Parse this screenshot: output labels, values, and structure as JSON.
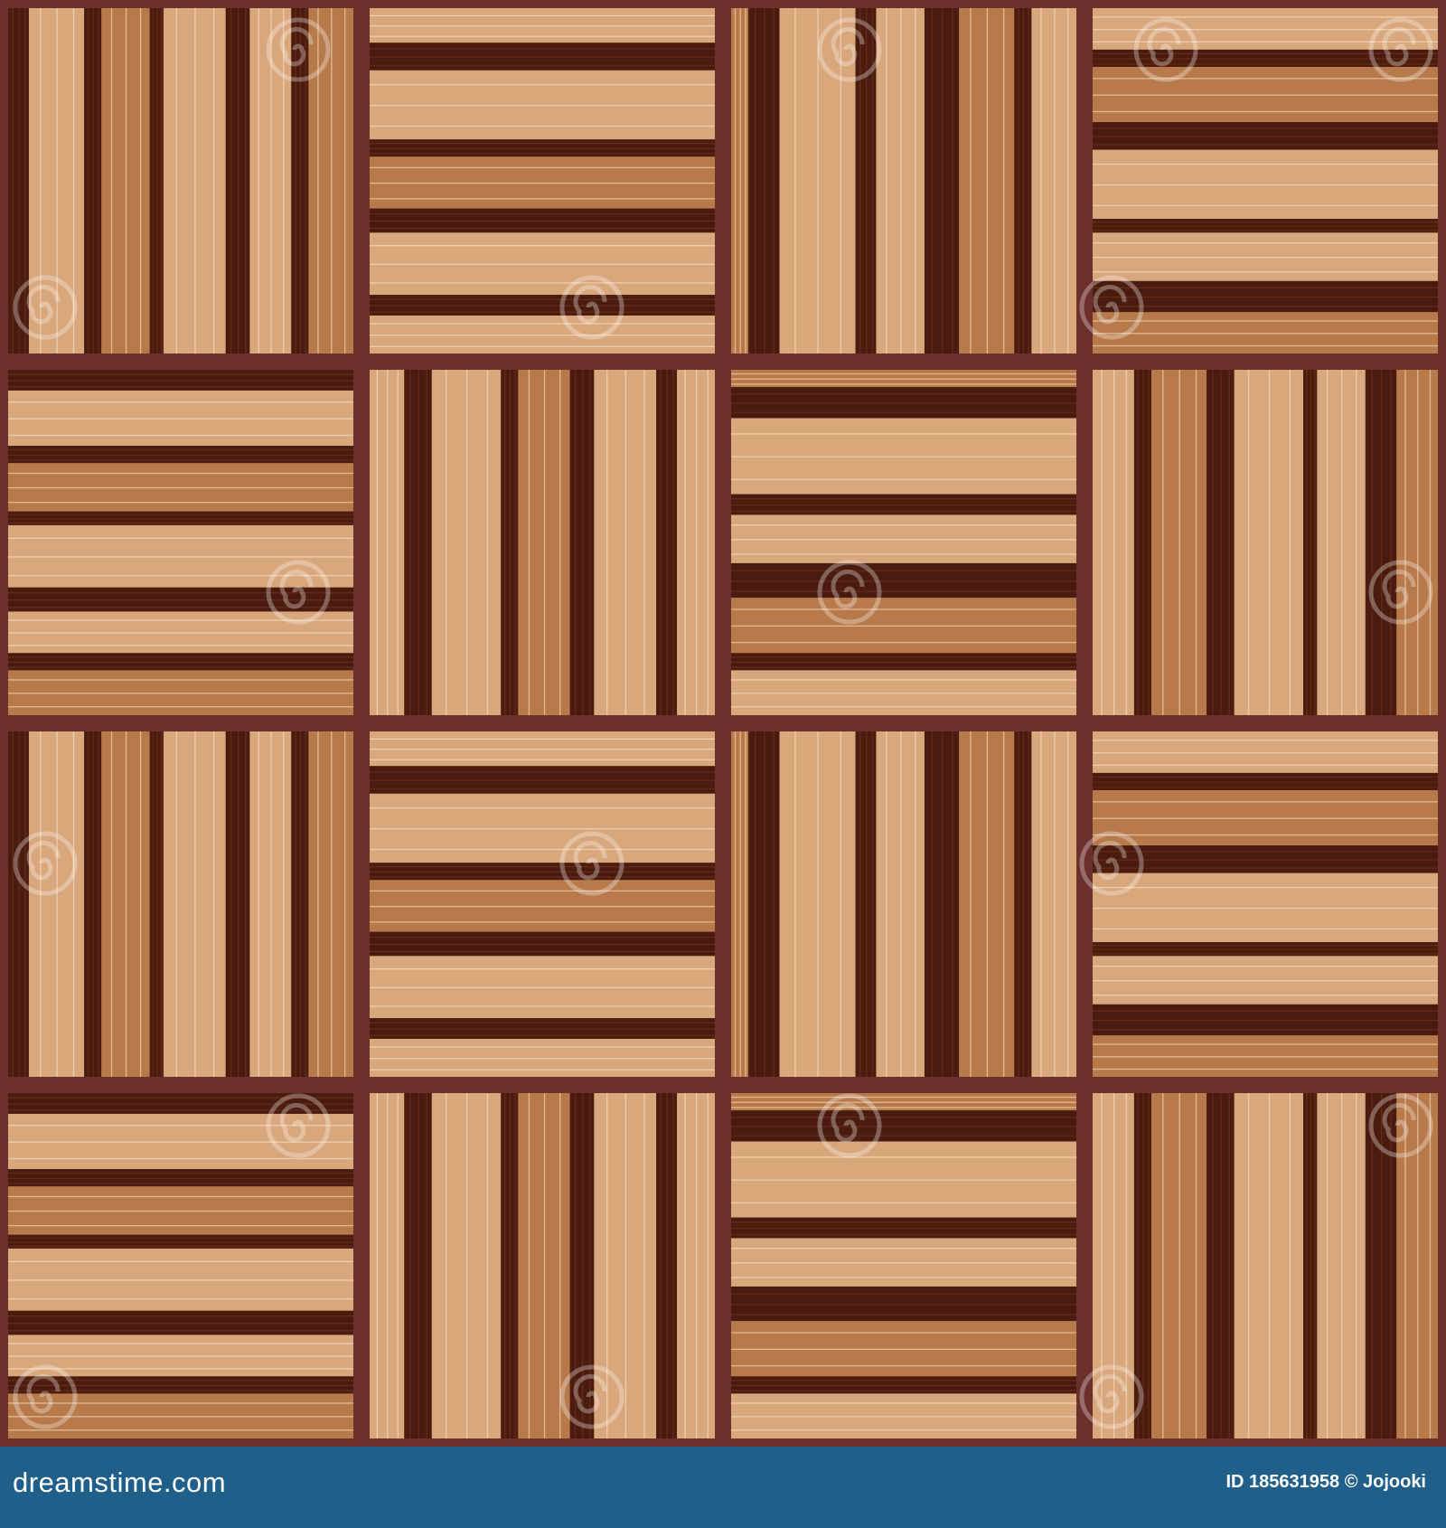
{
  "image": {
    "subject": "wood parquet tiles",
    "tile_orientations": [
      [
        "vertical",
        "horizontal",
        "vertical",
        "horizontal"
      ],
      [
        "horizontal",
        "vertical",
        "horizontal",
        "vertical"
      ],
      [
        "vertical",
        "horizontal",
        "vertical",
        "horizontal"
      ],
      [
        "horizontal",
        "vertical",
        "horizontal",
        "vertical"
      ]
    ],
    "colors": {
      "light_wood": "#d9a77c",
      "mid_wood": "#b87a4b",
      "dark_wood": "#4a1c0f",
      "frame": "#6b2f2c",
      "footer_bg": "#1f5f8a"
    }
  },
  "watermark": {
    "text": "dreamstime",
    "icon": "spiral-icon"
  },
  "footer": {
    "brand": "dreamstime.com",
    "id_label": "ID 185631958 © Jojooki"
  }
}
